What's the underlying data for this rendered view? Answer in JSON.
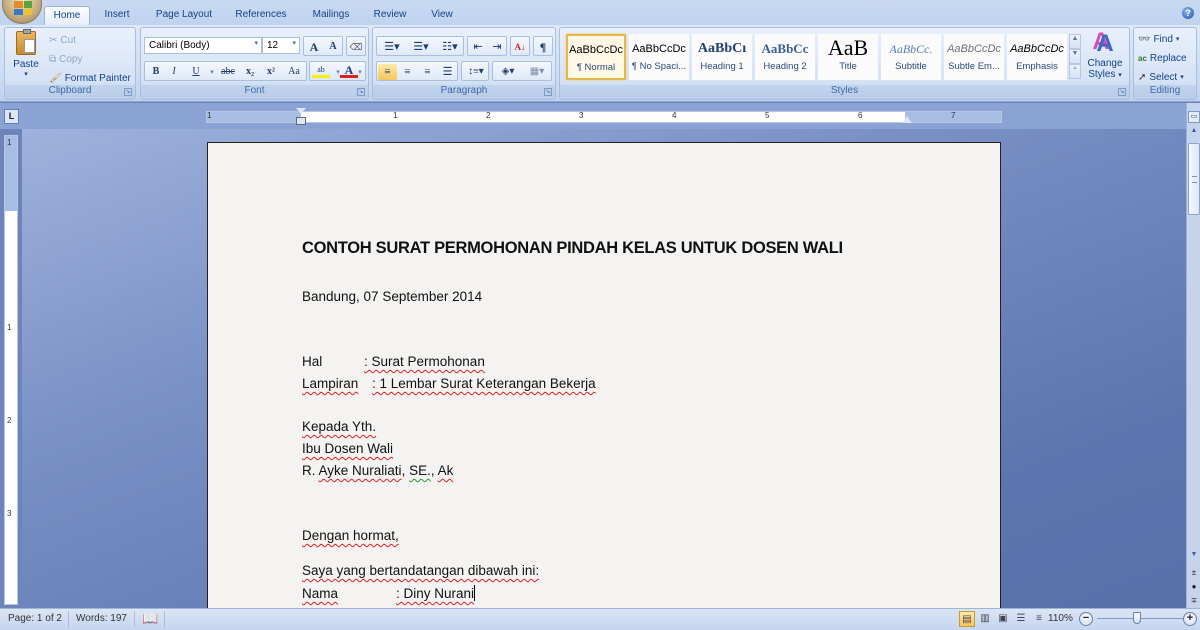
{
  "app": {
    "name": "Microsoft Word 2007"
  },
  "tabs": [
    {
      "label": "Home",
      "active": true
    },
    {
      "label": "Insert"
    },
    {
      "label": "Page Layout"
    },
    {
      "label": "References"
    },
    {
      "label": "Mailings"
    },
    {
      "label": "Review"
    },
    {
      "label": "View"
    }
  ],
  "help_icon": "?",
  "ribbon": {
    "clipboard": {
      "label": "Clipboard",
      "paste": "Paste",
      "cut": "Cut",
      "copy": "Copy",
      "format_painter": "Format Painter"
    },
    "font": {
      "label": "Font",
      "font_name": "Calibri (Body)",
      "font_size": "12",
      "grow": "A",
      "shrink": "A",
      "bold": "B",
      "italic": "I",
      "underline": "U",
      "strikethrough": "abc",
      "subscript": "x₂",
      "superscript": "x²",
      "change_case": "Aa",
      "highlight": "ab",
      "font_color": "A",
      "highlight_color": "#f5f200",
      "font_color_value": "#e0201c"
    },
    "paragraph": {
      "label": "Paragraph",
      "pilcrow": "¶"
    },
    "styles": {
      "label": "Styles",
      "items": [
        {
          "preview": "AaBbCcDc",
          "name": "¶ Normal",
          "selected": true
        },
        {
          "preview": "AaBbCcDc",
          "name": "¶ No Spaci..."
        },
        {
          "preview": "AaBbCı",
          "name": "Heading 1"
        },
        {
          "preview": "AaBbCc",
          "name": "Heading 2"
        },
        {
          "preview": "AaB",
          "name": "Title"
        },
        {
          "preview": "AaBbCc.",
          "name": "Subtitle"
        },
        {
          "preview": "AaBbCcDc",
          "name": "Subtle Em..."
        },
        {
          "preview": "AaBbCcDc",
          "name": "Emphasis"
        }
      ],
      "change_styles_line1": "Change",
      "change_styles_line2": "Styles"
    },
    "editing": {
      "label": "Editing",
      "find": "Find",
      "replace": "Replace",
      "select": "Select"
    }
  },
  "ruler": {
    "numbers": [
      "1",
      "1",
      "2",
      "3",
      "4",
      "5",
      "6",
      "7"
    ],
    "vnumbers": [
      "1",
      "1",
      "2",
      "3"
    ]
  },
  "document": {
    "title": "CONTOH SURAT PERMOHONAN PINDAH KELAS UNTUK DOSEN WALI",
    "date": "Bandung, 07 September 2014",
    "hal_label": "Hal",
    "hal_value": ": Surat Permohonan",
    "lampiran_label": "Lampiran",
    "lampiran_value": ": 1 Lembar Surat Keterangan Bekerja",
    "to_1": "Kepada Yth.",
    "to_2": "Ibu Dosen Wali",
    "to_3_a": "R. ",
    "to_3_b": "Ayke Nuraliati",
    "to_3_c": ", ",
    "to_3_d": "SE.",
    "to_3_e": ", ",
    "to_3_f": "Ak",
    "greeting": "Dengan hormat,",
    "intro": "Saya yang bertandatangan dibawah ini:",
    "nama_label": "Nama",
    "nama_value": ": Diny Nurani"
  },
  "status": {
    "page": "Page: 1 of 2",
    "words": "Words: 197",
    "zoom": "110%",
    "zoom_level_percent": 110
  }
}
